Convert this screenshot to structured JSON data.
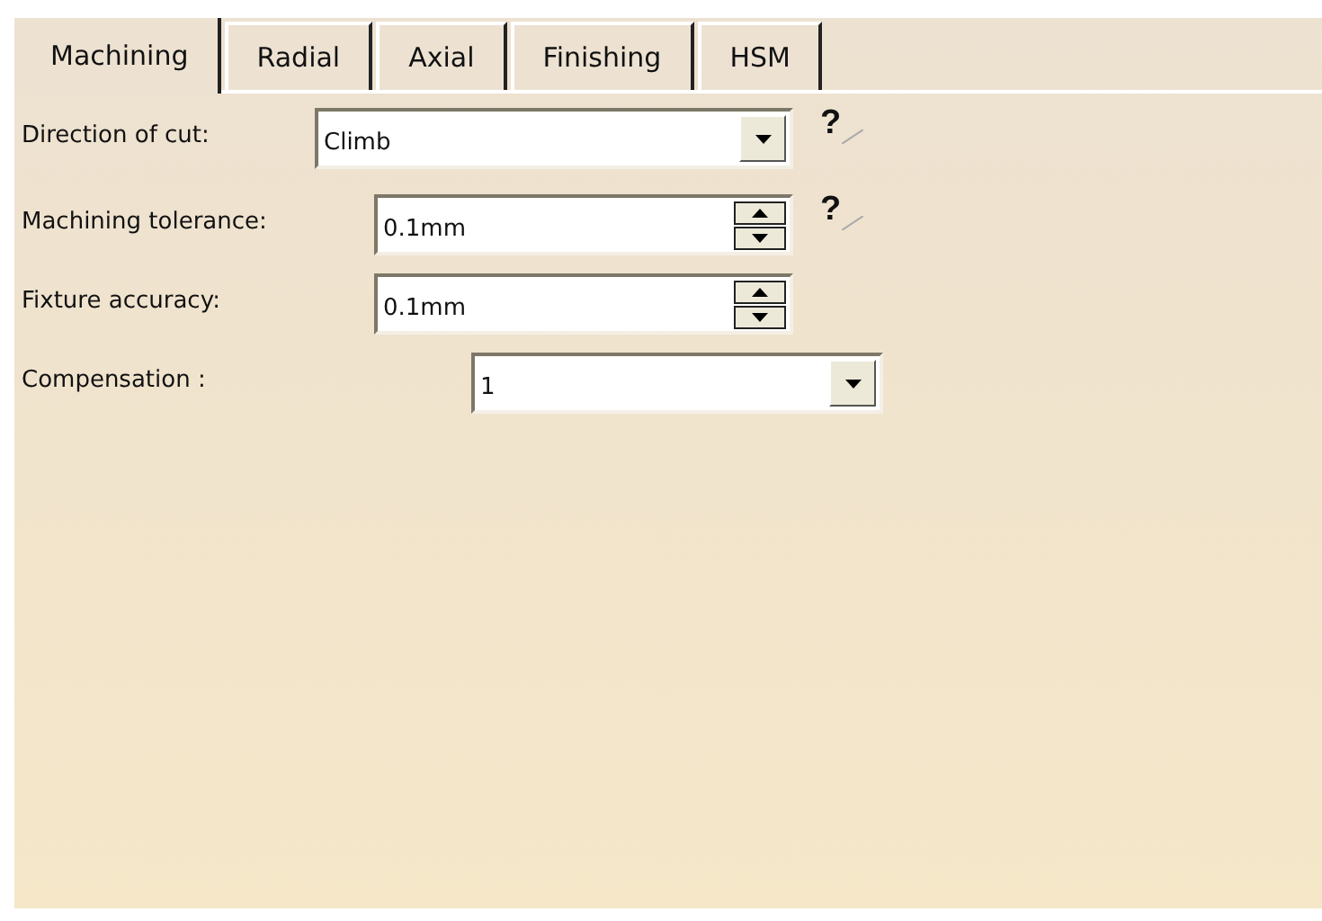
{
  "tabs": [
    {
      "label": "Machining",
      "selected": true
    },
    {
      "label": "Radial",
      "selected": false
    },
    {
      "label": "Axial",
      "selected": false
    },
    {
      "label": "Finishing",
      "selected": false
    },
    {
      "label": "HSM",
      "selected": false
    }
  ],
  "fields": [
    {
      "label": "Direction of cut:",
      "kind": "combo",
      "value": "Climb",
      "help": "?"
    },
    {
      "label": "Machining tolerance:",
      "kind": "spinner",
      "value": "0.1mm",
      "help": "?"
    },
    {
      "label": "Fixture accuracy:",
      "kind": "spinner",
      "value": "0.1mm"
    },
    {
      "label": "Compensation  :",
      "kind": "combo",
      "value": "1"
    }
  ]
}
